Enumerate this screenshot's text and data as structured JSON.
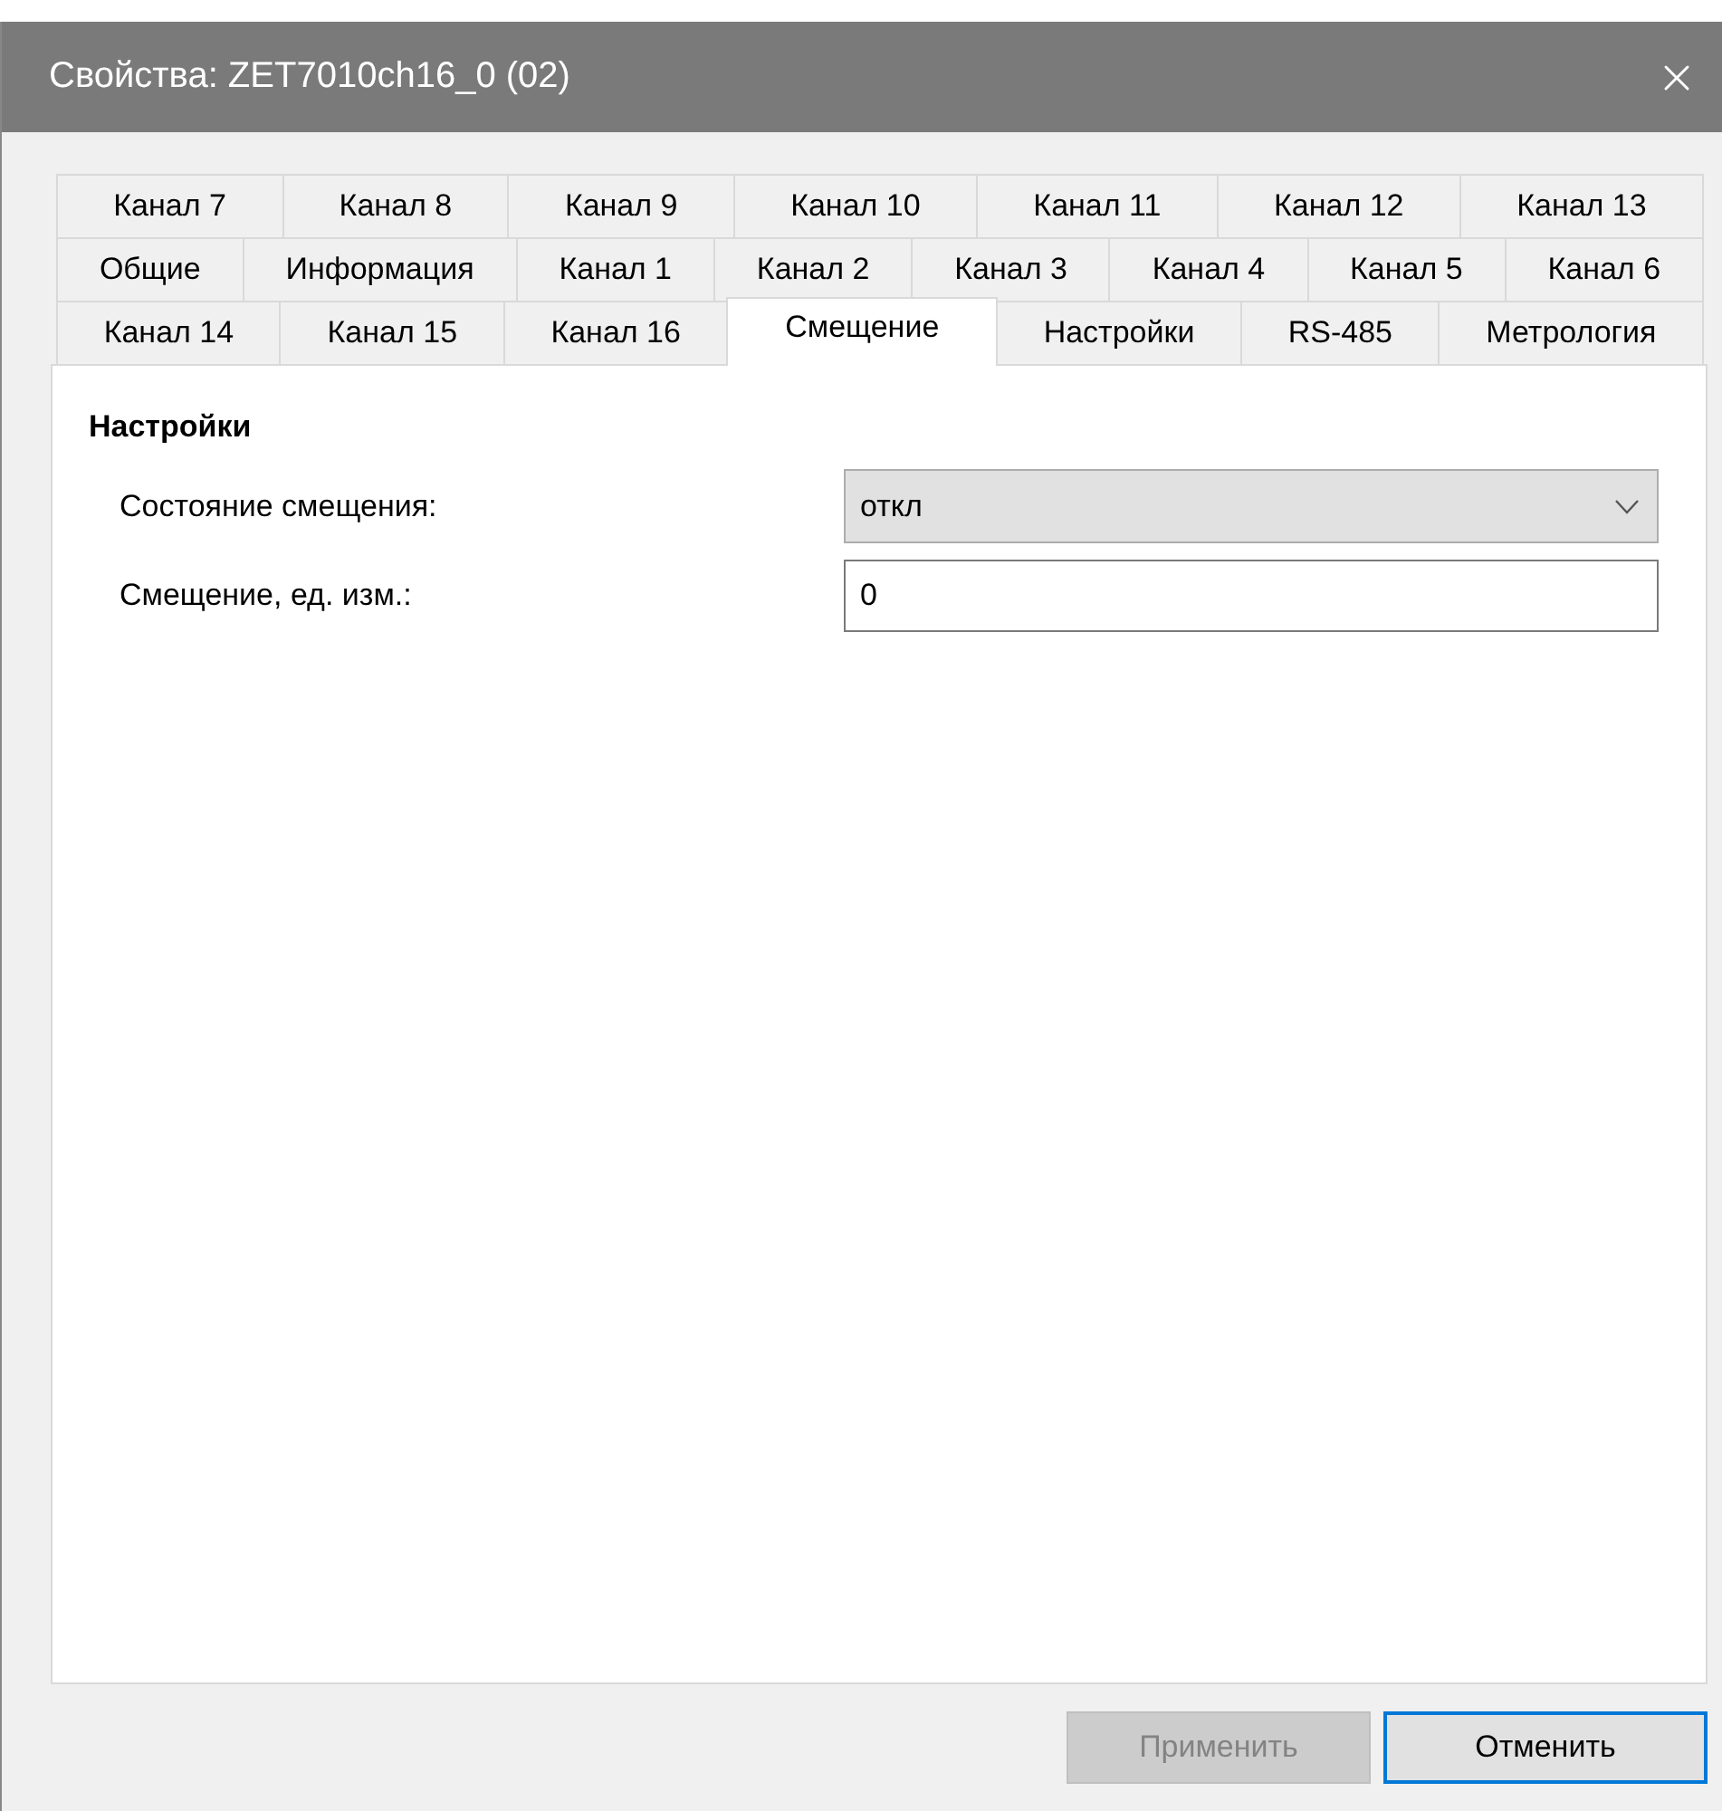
{
  "window": {
    "title": "Свойства: ZET7010ch16_0 (02)"
  },
  "tab_rows": [
    [
      {
        "label": "Канал 7",
        "selected": false
      },
      {
        "label": "Канал 8",
        "selected": false
      },
      {
        "label": "Канал 9",
        "selected": false
      },
      {
        "label": "Канал 10",
        "selected": false
      },
      {
        "label": "Канал 11",
        "selected": false
      },
      {
        "label": "Канал 12",
        "selected": false
      },
      {
        "label": "Канал 13",
        "selected": false
      }
    ],
    [
      {
        "label": "Общие",
        "selected": false
      },
      {
        "label": "Информация",
        "selected": false
      },
      {
        "label": "Канал 1",
        "selected": false
      },
      {
        "label": "Канал 2",
        "selected": false
      },
      {
        "label": "Канал 3",
        "selected": false
      },
      {
        "label": "Канал 4",
        "selected": false
      },
      {
        "label": "Канал 5",
        "selected": false
      },
      {
        "label": "Канал 6",
        "selected": false
      }
    ],
    [
      {
        "label": "Канал 14",
        "selected": false
      },
      {
        "label": "Канал 15",
        "selected": false
      },
      {
        "label": "Канал 16",
        "selected": false
      },
      {
        "label": "Смещение",
        "selected": true
      },
      {
        "label": "Настройки",
        "selected": false
      },
      {
        "label": "RS-485",
        "selected": false
      },
      {
        "label": "Метрология",
        "selected": false
      }
    ]
  ],
  "section": {
    "title": "Настройки"
  },
  "fields": [
    {
      "kind": "select",
      "label": "Состояние смещения:",
      "value": "откл"
    },
    {
      "kind": "text",
      "label": "Смещение, ед. изм.:",
      "value": "0"
    }
  ],
  "buttons": [
    {
      "label": "Применить",
      "disabled": true,
      "focused": false
    },
    {
      "label": "Отменить",
      "disabled": false,
      "focused": true
    }
  ]
}
